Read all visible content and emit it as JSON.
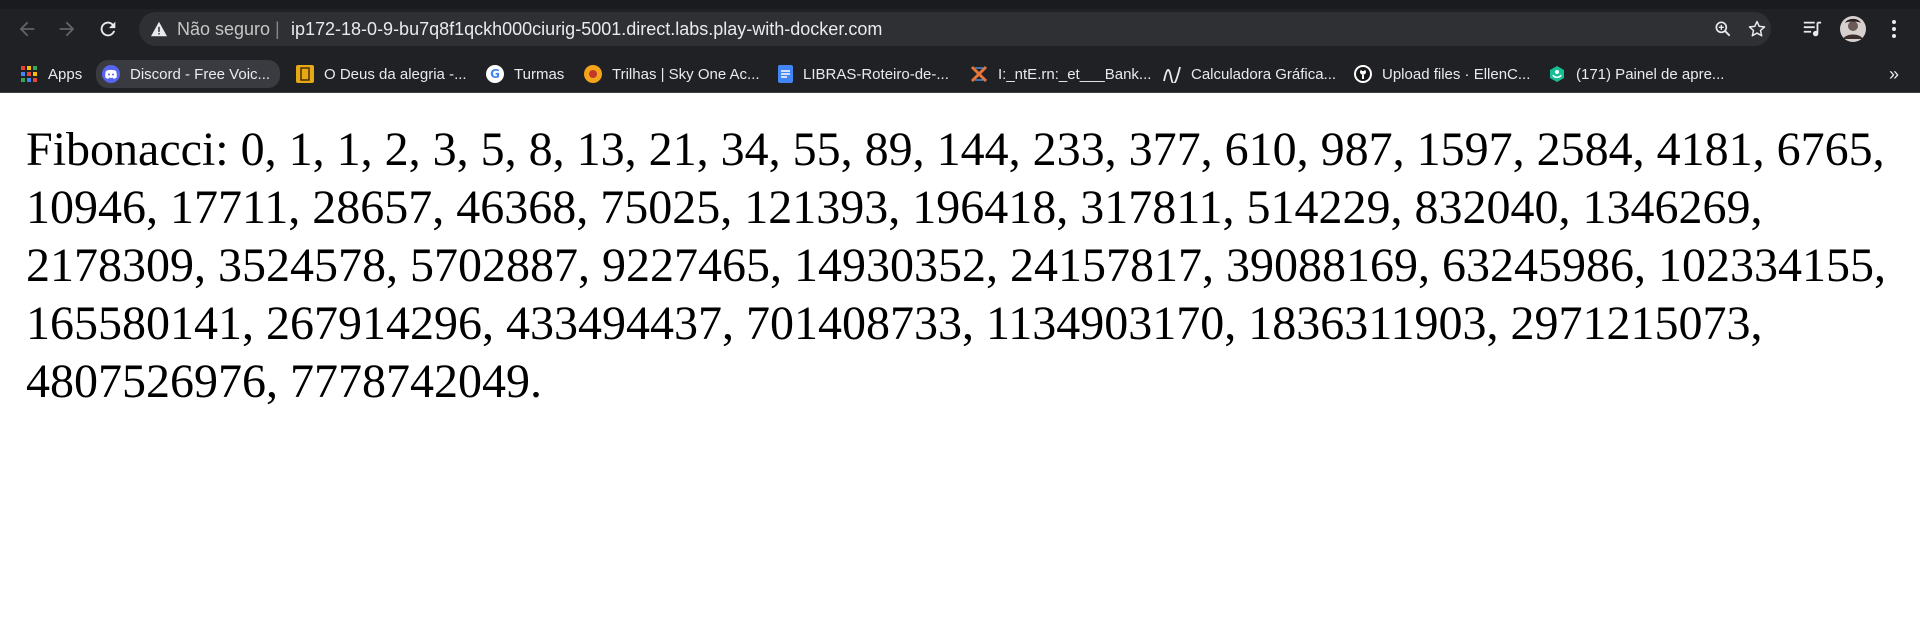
{
  "browser": {
    "security_label": "Não seguro",
    "separator": "|",
    "url": "ip172-18-0-9-bu7q8f1qckh000ciurig-5001.direct.labs.play-with-docker.com"
  },
  "bookmarks": [
    {
      "label": "Apps",
      "icon": "apps-grid-icon"
    },
    {
      "label": "Discord - Free Voic...",
      "icon": "discord-icon"
    },
    {
      "label": "O Deus da alegria -...",
      "icon": "book-icon"
    },
    {
      "label": "Turmas",
      "icon": "google-icon"
    },
    {
      "label": "Trilhas | Sky One Ac...",
      "icon": "sky-one-icon"
    },
    {
      "label": "LIBRAS-Roteiro-de-...",
      "icon": "google-docs-icon"
    },
    {
      "label": "I:_ntE.rn:_et___Bank...",
      "icon": "cross-icon"
    },
    {
      "label": "Calculadora Gráfica...",
      "icon": "desmos-icon"
    },
    {
      "label": "Upload files · EllenC...",
      "icon": "github-icon"
    },
    {
      "label": "(171) Painel de apre...",
      "icon": "khan-academy-icon"
    }
  ],
  "page": {
    "fibonacci_text": "Fibonacci: 0, 1, 1, 2, 3, 5, 8, 13, 21, 34, 55, 89, 144, 233, 377, 610, 987, 1597, 2584, 4181, 6765, 10946, 17711, 28657, 46368, 75025, 121393, 196418, 317811, 514229, 832040, 1346269, 2178309, 3524578, 5702887, 9227465, 14930352, 24157817, 39088169, 63245986, 102334155, 165580141, 267914296, 433494437, 701408733, 1134903170, 1836311903, 2971215073, 4807526976, 7778742049."
  }
}
